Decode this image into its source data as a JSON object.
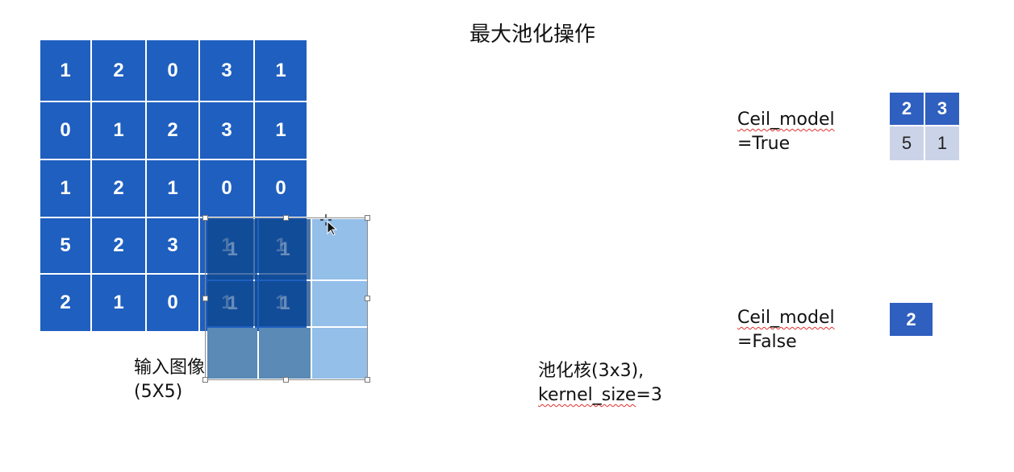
{
  "title": "最大池化操作",
  "input_image": {
    "cells": [
      [
        "1",
        "2",
        "0",
        "3",
        "1"
      ],
      [
        "0",
        "1",
        "2",
        "3",
        "1"
      ],
      [
        "1",
        "2",
        "1",
        "0",
        "0"
      ],
      [
        "5",
        "2",
        "3",
        "1",
        "1"
      ],
      [
        "2",
        "1",
        "0",
        "1",
        "1"
      ]
    ],
    "label_line1": "输入图像",
    "label_line2": "(5X5)"
  },
  "kernel": {
    "cells": [
      [
        "1",
        "1",
        ""
      ],
      [
        "1",
        "1",
        ""
      ],
      [
        "",
        "",
        ""
      ]
    ],
    "label_line1": "池化核(3x3),",
    "label_line2_word": "kernel_size",
    "label_line2_rest": "=3"
  },
  "ceil_true": {
    "label_word": "Ceil_model",
    "label_line2": "=True",
    "output": [
      [
        "2",
        "3"
      ],
      [
        "5",
        "1"
      ]
    ]
  },
  "ceil_false": {
    "label_word": "Ceil_model",
    "label_line2": "=False",
    "output": [
      [
        "2"
      ]
    ]
  },
  "colors": {
    "input_cell": "#1f5fbf",
    "kernel_overlay": "#93bfe9",
    "output_dark": "#2f5fbf",
    "output_light": "#cbd3e8"
  }
}
